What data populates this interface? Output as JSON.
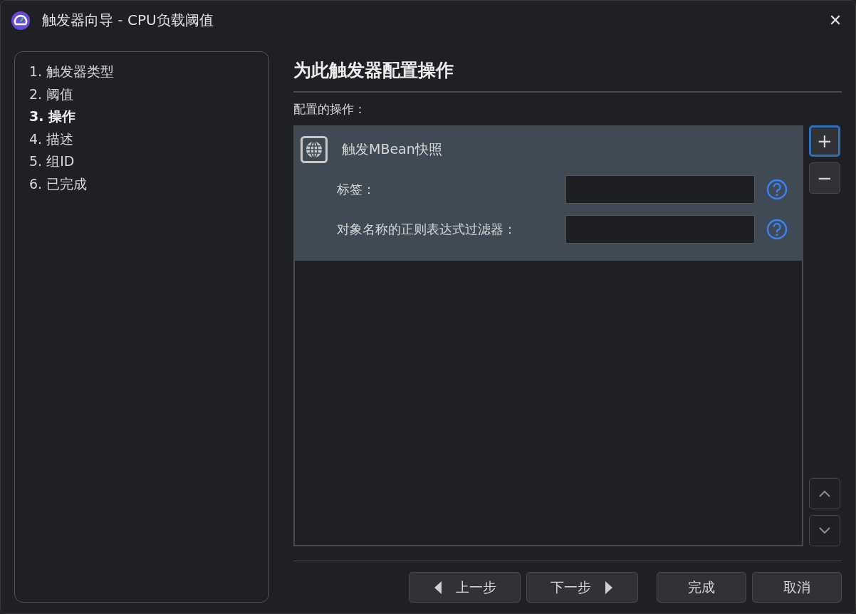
{
  "window": {
    "title": "触发器向导 - CPU负载阈值",
    "close": "✕"
  },
  "steps": [
    {
      "label": "1. 触发器类型",
      "selected": false
    },
    {
      "label": "2. 阈值",
      "selected": false
    },
    {
      "label": "3. 操作",
      "selected": true
    },
    {
      "label": "4. 描述",
      "selected": false
    },
    {
      "label": "5. 组ID",
      "selected": false
    },
    {
      "label": "6. 已完成",
      "selected": false
    }
  ],
  "page": {
    "heading": "为此触发器配置操作",
    "list_label": "配置的操作："
  },
  "actions": [
    {
      "name": "触发MBean快照",
      "selected": true,
      "fields": [
        {
          "label": "标签："
        },
        {
          "label": "对象名称的正则表达式过滤器："
        }
      ]
    }
  ],
  "side_buttons": [
    {
      "kind": "add",
      "symbol": "+",
      "focused": true
    },
    {
      "kind": "remove",
      "symbol": "−",
      "focused": false
    },
    {
      "kind": "up",
      "focused": false
    },
    {
      "kind": "down",
      "focused": false
    }
  ],
  "buttons": [
    {
      "label": "上一步",
      "kind": "back"
    },
    {
      "label": "下一步",
      "kind": "next"
    },
    {
      "label": "完成",
      "kind": "plain"
    },
    {
      "label": "取消",
      "kind": "plain"
    }
  ]
}
